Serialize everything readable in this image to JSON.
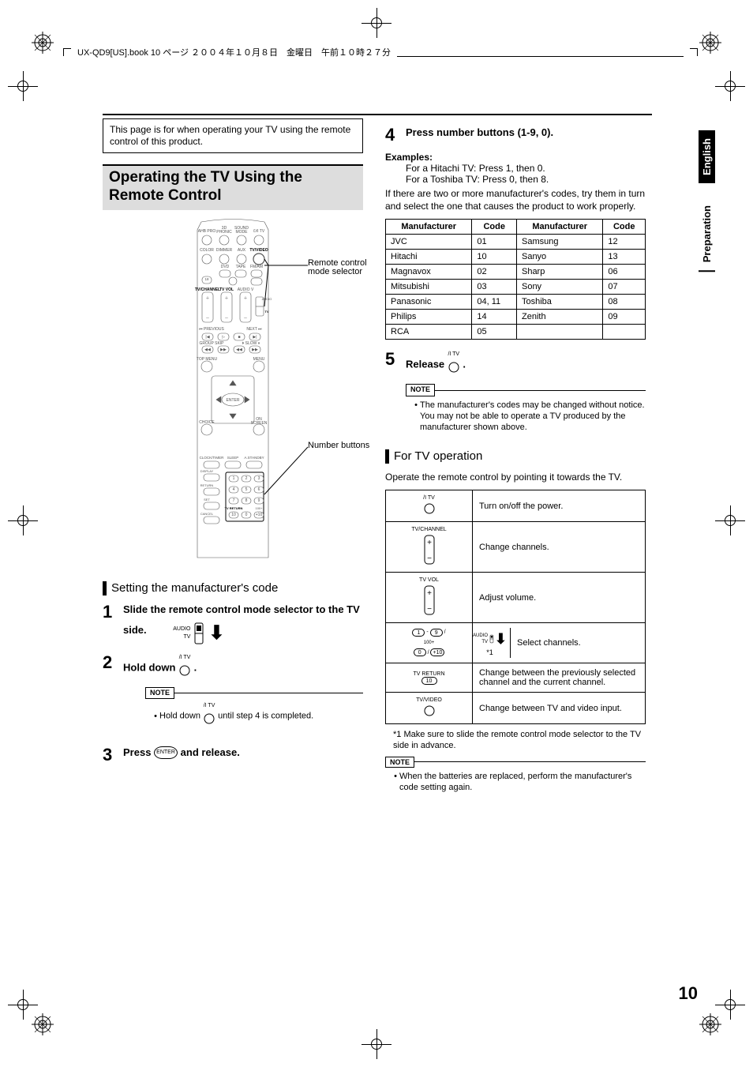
{
  "header": "UX-QD9[US].book  10 ページ  ２００４年１０月８日　金曜日　午前１０時２７分",
  "side": {
    "language": "English",
    "section": "Preparation"
  },
  "intro": "This page is for when operating your TV using the remote control of this product.",
  "title": "Operating the TV Using the Remote Control",
  "remote_labels": {
    "annot1": "Remote control mode selector",
    "annot2": "Number buttons",
    "row1": [
      "AHB PRO",
      "3D PHONIC",
      "SOUND MODE",
      "  /I TV"
    ],
    "row2": [
      "COLOR",
      "DIMMER",
      "AUX",
      "TV/VIDEO"
    ],
    "row3": [
      "DVD",
      "TAPE",
      "FM/AM"
    ],
    "row4": [
      "TV/CHANNEL",
      "TV VOL",
      "AUDIO V"
    ],
    "audio_tv": [
      "AUDIO",
      "TV"
    ],
    "prev_next": [
      "PREVIOUS",
      "NEXT"
    ],
    "group_slow": [
      "GROUP SKIP",
      "SLOW"
    ],
    "menus": [
      "TOP MENU",
      "MENU"
    ],
    "enter": "ENTER",
    "choice_onscreen": [
      "CHOICE",
      "ON SCREEN"
    ],
    "bottom_row": [
      "CLOCK/TIMER",
      "SLEEP",
      "A.STANDBY"
    ],
    "bottom_lbls": [
      "DISPLAY",
      "RETURN",
      "SET",
      "CANCEL",
      "TV RETURN",
      "100+"
    ],
    "numbers": [
      "1",
      "2",
      "3",
      "4",
      "5",
      "6",
      "7",
      "8",
      "9",
      "10",
      "0",
      "+10"
    ]
  },
  "subhead1": "Setting the manufacturer's code",
  "step1": "Slide the remote control mode selector to the TV side.",
  "step2_lead": "Hold down ",
  "step2_tail": ".",
  "step2_btn_top": "  /I TV",
  "step2_note": "Hold down          until step 4 is completed.",
  "step3_lead": "Press ",
  "step3_mid": " and release.",
  "step3_enter": "ENTER",
  "step4_lead": "Press number buttons (1-9, 0).",
  "examples_label": "Examples:",
  "example1": "For a Hitachi TV: Press 1, then 0.",
  "example2": "For a Toshiba TV: Press 0, then 8.",
  "multi_code_note": "If there are two or more manufacturer's codes, try them in turn and select the one that causes the product to work properly.",
  "table_headers": [
    "Manufacturer",
    "Code",
    "Manufacturer",
    "Code"
  ],
  "table_rows": [
    [
      "JVC",
      "01",
      "Samsung",
      "12"
    ],
    [
      "Hitachi",
      "10",
      "Sanyo",
      "13"
    ],
    [
      "Magnavox",
      "02",
      "Sharp",
      "06"
    ],
    [
      "Mitsubishi",
      "03",
      "Sony",
      "07"
    ],
    [
      "Panasonic",
      "04, 11",
      "Toshiba",
      "08"
    ],
    [
      "Philips",
      "14",
      "Zenith",
      "09"
    ],
    [
      "RCA",
      "05",
      "",
      ""
    ]
  ],
  "step5_lead": "Release ",
  "step5_tail": ".",
  "step5_btn_top": "  /I TV",
  "step5_note": "The manufacturer's codes may be changed without notice. You may not be able to operate a TV produced by the manufacturer shown above.",
  "subhead2": "For TV operation",
  "op_intro": "Operate the remote control by pointing it towards the TV.",
  "op_rows": [
    {
      "icon_label": "  /I TV",
      "desc": "Turn on/off the power."
    },
    {
      "icon_label": "TV/CHANNEL",
      "desc": "Change channels."
    },
    {
      "icon_label": "TV VOL",
      "desc": "Adjust volume."
    },
    {
      "icon_label": "numbers",
      "split_label_top": "AUDIO",
      "split_label_bot": "TV",
      "split_foot": "*1",
      "desc": "Select channels."
    },
    {
      "icon_label": "TV RETURN",
      "icon_sub": "10",
      "desc": "Change between the previously selected channel and the current channel."
    },
    {
      "icon_label": "TV/VIDEO",
      "desc": "Change between TV and video input."
    }
  ],
  "op_num_labels": {
    "one": "1",
    "nine": "9",
    "zero": "0",
    "hundred": "100+",
    "plus10": "+10"
  },
  "footnote": "*1  Make sure to slide the remote control mode selector to the TV side in advance.",
  "final_note": "When the batteries are replaced, perform the manufacturer's code setting again.",
  "note_label": "NOTE",
  "page_number": "10",
  "switch_labels": {
    "audio": "AUDIO",
    "tv": "TV"
  }
}
